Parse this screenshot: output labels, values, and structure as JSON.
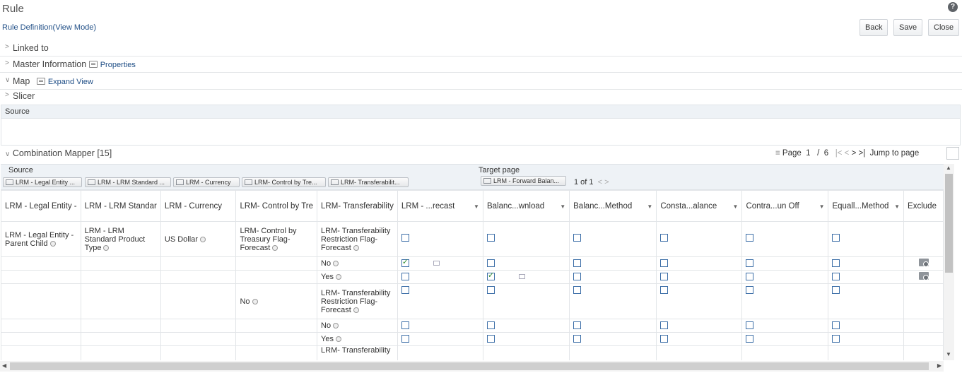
{
  "header": {
    "title": "Rule",
    "subtitle": "Rule Definition(View Mode)",
    "help": "?",
    "buttons": {
      "back": "Back",
      "save": "Save",
      "close": "Close"
    }
  },
  "sections": {
    "linked_to": "Linked to",
    "master_info": "Master Information",
    "properties_link": "Properties",
    "map": "Map",
    "expand_view_link": "Expand View",
    "slicer": "Slicer"
  },
  "source_bar": {
    "label": "Source"
  },
  "combination_mapper": {
    "title": "Combination Mapper [15]",
    "pager": {
      "page_label": "Page",
      "current": "1",
      "sep": "/",
      "total": "6",
      "jump_label": "Jump to page"
    },
    "source_label": "Source",
    "target_label": "Target page",
    "source_chips": [
      "LRM - Legal Entity ...",
      "LRM - LRM Standard ...",
      "LRM - Currency",
      "LRM- Control by Tre...",
      "LRM- Transferabilit..."
    ],
    "target_chip": "LRM - Forward Balan...",
    "target_pager": "1 of 1"
  },
  "grid": {
    "columns": [
      "LRM - Legal Entity -",
      "LRM - LRM Standar",
      "LRM - Currency",
      "LRM- Control by Tre",
      "LRM- Transferability",
      "LRM - ...recast",
      "Balanc...wnload",
      "Balanc...Method",
      "Consta...alance",
      "Contra...un Off",
      "Equall...Method",
      "Exclude"
    ],
    "rows": [
      {
        "c0": "LRM - Legal Entity - Parent Child",
        "c1": "LRM - LRM Standard Product Type",
        "c2": "US Dollar",
        "c3": "LRM- Control by Treasury Flag- Forecast",
        "c4": "LRM- Transferability Restriction Flag- Forecast"
      },
      {
        "c4": "No",
        "checked_col": 5,
        "exclude": true
      },
      {
        "c4": "Yes",
        "checked_col": 6,
        "exclude": true
      },
      {
        "c3": "No",
        "c4": "LRM- Transferability Restriction Flag- Forecast"
      },
      {
        "c4": "No"
      },
      {
        "c4": "Yes"
      },
      {
        "c4": "LRM- Transferability"
      }
    ]
  },
  "colors": {
    "link": "#1f4e86",
    "checkbox_border": "#3d6fa8",
    "check": "#2e8b2e",
    "panel_bg": "#eef2f6"
  }
}
